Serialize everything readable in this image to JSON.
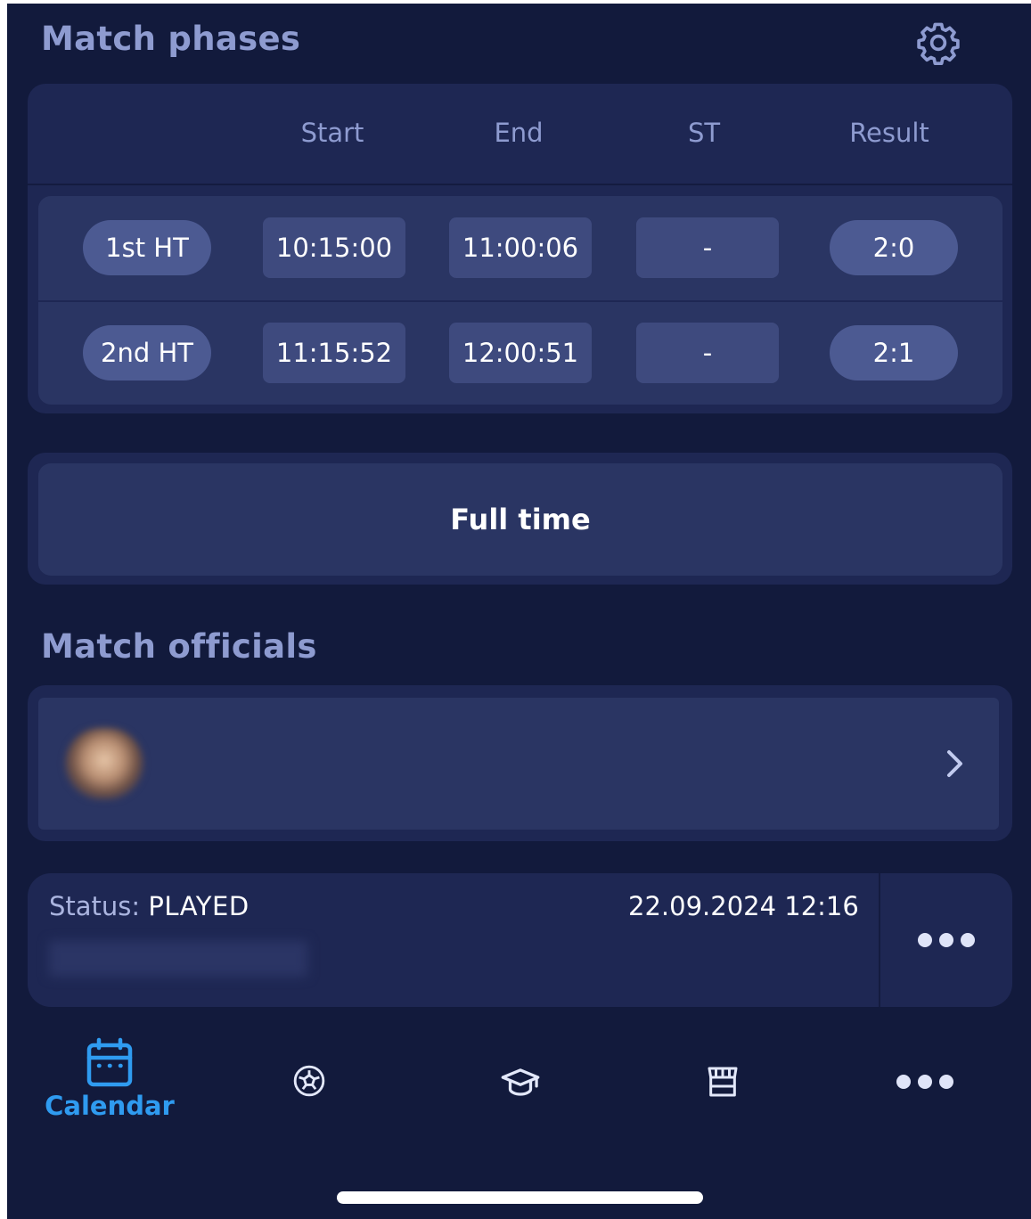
{
  "match_phases": {
    "title": "Match phases",
    "settings_icon": "gear-icon",
    "columns": [
      "Start",
      "End",
      "ST",
      "Result"
    ],
    "rows": [
      {
        "phase": "1st HT",
        "start": "10:15:00",
        "end": "11:00:06",
        "st": "-",
        "result": "2:0"
      },
      {
        "phase": "2nd HT",
        "start": "11:15:52",
        "end": "12:00:51",
        "st": "-",
        "result": "2:1"
      }
    ]
  },
  "full_time_button": "Full time",
  "match_officials": {
    "title": "Match officials",
    "official": {
      "avatar": "avatar-photo",
      "name": "",
      "role": ""
    },
    "chevron_icon": "chevron-right-icon"
  },
  "status_bar": {
    "label": "Status:",
    "value": "PLAYED",
    "datetime": "22.09.2024 12:16",
    "author": "",
    "more_icon": "more-horizontal-icon"
  },
  "bottom_nav": {
    "items": [
      {
        "label": "Calendar",
        "icon": "calendar-icon",
        "active": true
      },
      {
        "label": "",
        "icon": "soccer-ball-icon",
        "active": false
      },
      {
        "label": "",
        "icon": "graduation-cap-icon",
        "active": false
      },
      {
        "label": "",
        "icon": "store-icon",
        "active": false
      },
      {
        "label": "",
        "icon": "more-horizontal-icon",
        "active": false
      }
    ]
  },
  "colors": {
    "background": "#121a3c",
    "card": "#1e2753",
    "card_inner": "#2a3563",
    "pill": "#4c5a92",
    "time_box": "#3e4a7e",
    "heading": "#8e9bd0",
    "accent": "#2f9bf0"
  }
}
